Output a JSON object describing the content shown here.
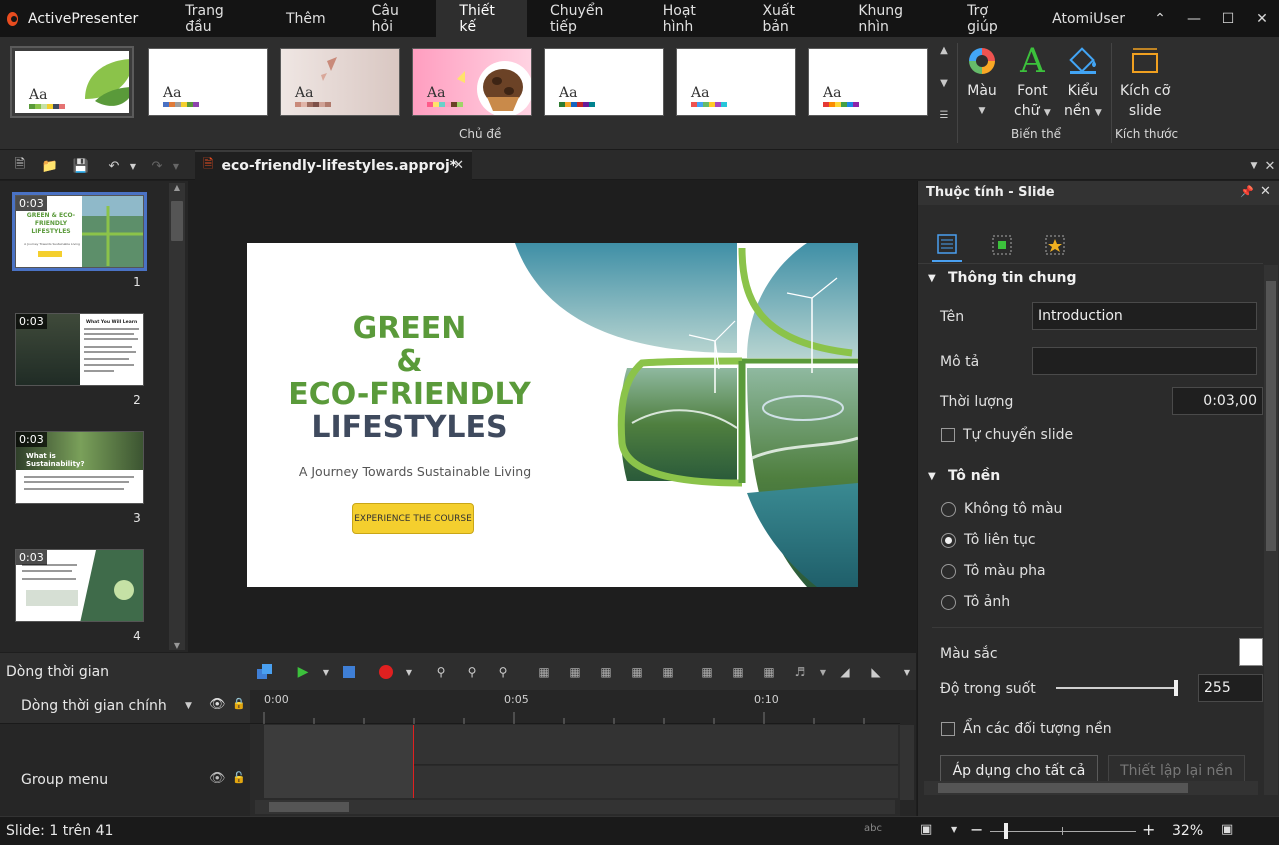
{
  "app": {
    "title": "ActivePresenter",
    "user": "AtomiUser"
  },
  "menu": {
    "tabs": [
      "Trang đầu",
      "Thêm",
      "Câu hỏi",
      "Thiết kế",
      "Chuyển tiếp",
      "Hoạt hình",
      "Xuất bản",
      "Khung nhìn",
      "Trợ giúp"
    ],
    "active": "Thiết kế"
  },
  "ribbon": {
    "themes_label": "Chủ đề",
    "theme_aa": "Aa",
    "variants_label": "Biến thể",
    "size_label": "Kích thước",
    "color_btn": "Màu",
    "font_btn_line1": "Font",
    "font_btn_line2": "chữ",
    "bg_btn_line1": "Kiểu",
    "bg_btn_line2": "nền",
    "size_btn_line1": "Kích cỡ",
    "size_btn_line2": "slide"
  },
  "document": {
    "tab_name": "eco-friendly-lifestyles.approj*"
  },
  "thumbnails": [
    {
      "num": "1",
      "duration": "0:03"
    },
    {
      "num": "2",
      "duration": "0:03"
    },
    {
      "num": "3",
      "duration": "0:03"
    },
    {
      "num": "4",
      "duration": "0:03"
    }
  ],
  "thumb_texts": {
    "t1_title": "GREEN & ECO-FRIENDLY LIFESTYLES",
    "t1_sub": "A Journey Towards Sustainable Living",
    "t2_title": "What You Will Learn",
    "t3_title": "What is Sustainability?"
  },
  "slide": {
    "title_line1": "GREEN",
    "title_line2": "&",
    "title_line3": "ECO-FRIENDLY",
    "title_line4": "LIFESTYLES",
    "subtitle": "A Journey Towards Sustainable Living",
    "button": "EXPERIENCE THE COURSE"
  },
  "timeline": {
    "title": "Dòng thời gian",
    "main_row": "Dòng thời gian chính",
    "group_row": "Group menu",
    "ruler": [
      "0:00",
      "0:05",
      "0:10"
    ]
  },
  "properties": {
    "header": "Thuộc tính - Slide",
    "general_section": "Thông tin chung",
    "name_label": "Tên",
    "name_value": "Introduction",
    "desc_label": "Mô tả",
    "desc_value": "",
    "duration_label": "Thời lượng",
    "duration_value": "0:03,00",
    "auto_advance": "Tự chuyển slide",
    "fill_section": "Tô nền",
    "fill_options": [
      "Không tô màu",
      "Tô liên tục",
      "Tô màu pha",
      "Tô ảnh"
    ],
    "fill_selected": "Tô liên tục",
    "color_label": "Màu sắc",
    "opacity_label": "Độ trong suốt",
    "opacity_value": "255",
    "hide_bg_objects": "Ẩn các đối tượng nền",
    "apply_all": "Áp dụng cho tất cả",
    "reset_bg": "Thiết lập lại nền"
  },
  "status": {
    "slide_info": "Slide: 1 trên 41",
    "zoom": "32%"
  },
  "colors": {
    "accent_blue": "#4a72c4",
    "title_green": "#5a9a3a",
    "title_navy": "#3f4a5e",
    "button_yellow": "#f4cf2e",
    "record_red": "#e02020",
    "play_green": "#3cc13c"
  }
}
